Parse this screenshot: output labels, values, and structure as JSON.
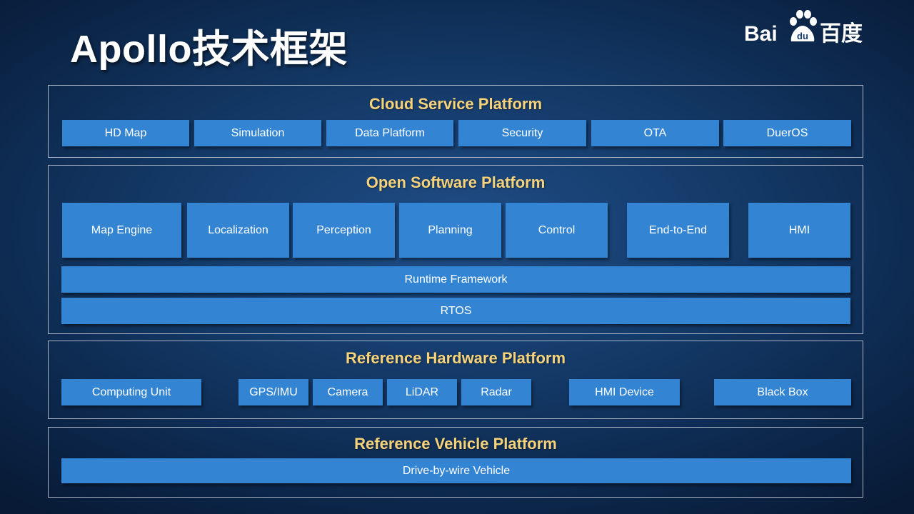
{
  "slide": {
    "title": "Apollo技术框架"
  },
  "logo": {
    "latin_text": "Bai",
    "paw_text": "du",
    "chinese_text": "百度",
    "color": "#ffffff"
  },
  "colors": {
    "box_fill": "#3385d4",
    "layer_title": "#f6d27a",
    "layer_border": "#aab4c4"
  },
  "cloud": {
    "title": "Cloud Service Platform",
    "items": [
      "HD Map",
      "Simulation",
      "Data Platform",
      "Security",
      "OTA",
      "DuerOS"
    ]
  },
  "software": {
    "title": "Open Software Platform",
    "modules": [
      "Map Engine",
      "Localization",
      "Perception",
      "Planning",
      "Control",
      "End-to-End",
      "HMI"
    ],
    "runtime": "Runtime  Framework",
    "rtos": "RTOS"
  },
  "hardware": {
    "title": "Reference Hardware Platform",
    "items": [
      "Computing  Unit",
      "GPS/IMU",
      "Camera",
      "LiDAR",
      "Radar",
      "HMI Device",
      "Black Box"
    ]
  },
  "vehicle": {
    "title": "Reference Vehicle Platform",
    "item": "Drive-by-wire Vehicle"
  }
}
